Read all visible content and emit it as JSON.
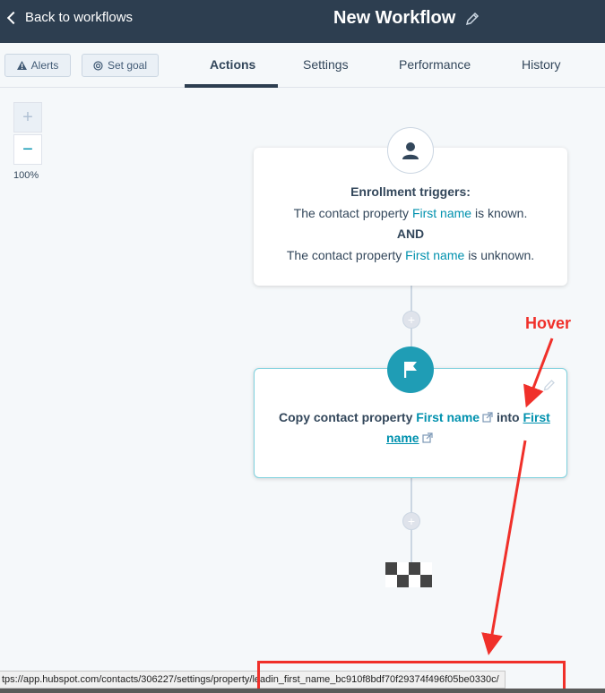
{
  "header": {
    "back_label": "Back to workflows",
    "title": "New Workflow"
  },
  "toolbar": {
    "alerts_label": "Alerts",
    "goal_label": "Set goal",
    "tabs": [
      {
        "label": "Actions",
        "active": true
      },
      {
        "label": "Settings",
        "active": false
      },
      {
        "label": "Performance",
        "active": false
      },
      {
        "label": "History",
        "active": false
      }
    ]
  },
  "zoom": {
    "plus": "+",
    "minus": "−",
    "level": "100%"
  },
  "trigger_card": {
    "heading": "Enrollment triggers:",
    "line1_prefix": "The contact property",
    "line1_link": "First name",
    "line1_suffix": "is known.",
    "connector": "AND",
    "line2_prefix": "The contact property",
    "line2_link": "First name",
    "line2_suffix": "is unknown."
  },
  "action_card": {
    "prefix": "Copy contact property",
    "source_link": "First name",
    "middle": "into",
    "target_link_part1": "First",
    "target_link_part2": "name"
  },
  "add_buttons": {
    "symbol": "+"
  },
  "annotation": {
    "hover_label": "Hover",
    "color": "#f0302a"
  },
  "status_url": "tps://app.hubspot.com/contacts/306227/settings/property/leadin_first_name_bc910f8bdf70f29374f496f05be0330c/",
  "colors": {
    "header_bg": "#2d3e50",
    "accent": "#0091ae",
    "action_icon_bg": "#1f9db5"
  },
  "icons": {
    "back": "chevron-left-icon",
    "edit": "pencil-icon",
    "alerts": "warning-icon",
    "goal": "target-icon",
    "trigger": "person-icon",
    "action": "flag-icon",
    "external": "external-link-icon",
    "end": "checkered-flag-icon"
  }
}
